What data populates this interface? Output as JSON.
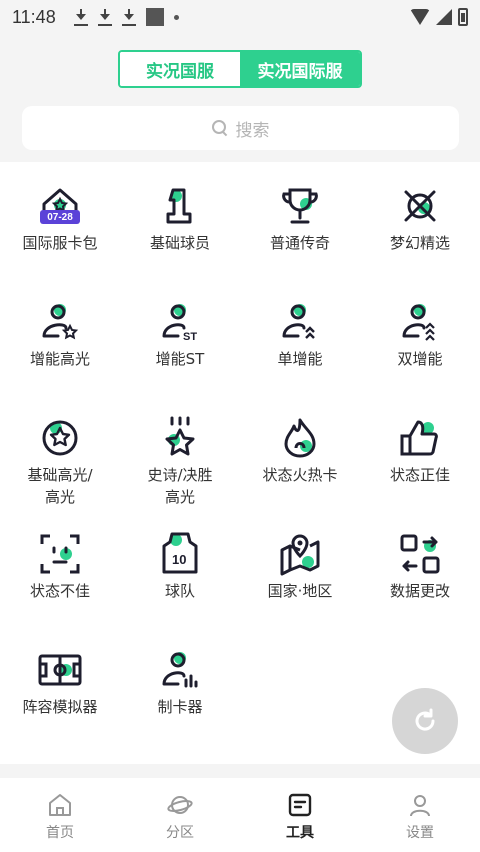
{
  "status_bar": {
    "time": "11:48"
  },
  "toggle": {
    "left_label": "实况国服",
    "right_label": "实况国际服",
    "active": "right"
  },
  "search": {
    "placeholder": "搜索"
  },
  "colors": {
    "accent": "#2ed08f",
    "badge": "#5b42d8"
  },
  "grid": {
    "items": [
      {
        "label": "国际服卡包",
        "icon": "house-star-icon",
        "badge": "07-28"
      },
      {
        "label": "基础球员",
        "icon": "number-one-icon"
      },
      {
        "label": "普通传奇",
        "icon": "trophy-icon"
      },
      {
        "label": "梦幻精选",
        "icon": "crossed-swords-icon"
      },
      {
        "label": "增能高光",
        "icon": "player-star-icon"
      },
      {
        "label": "增能ST",
        "icon": "player-st-icon"
      },
      {
        "label": "单增能",
        "icon": "player-chevron-icon"
      },
      {
        "label": "双增能",
        "icon": "player-double-chevron-icon"
      },
      {
        "label": "基础高光/\n高光",
        "icon": "star-circle-icon"
      },
      {
        "label": "史诗/决胜\n高光",
        "icon": "star-rain-icon"
      },
      {
        "label": "状态火热卡",
        "icon": "flame-icon"
      },
      {
        "label": "状态正佳",
        "icon": "thumbs-up-icon"
      },
      {
        "label": "状态不佳",
        "icon": "scan-face-icon"
      },
      {
        "label": "球队",
        "icon": "jersey-icon",
        "jersey_number": "10"
      },
      {
        "label": "国家·地区",
        "icon": "map-pin-icon"
      },
      {
        "label": "数据更改",
        "icon": "swap-boxes-icon"
      },
      {
        "label": "阵容模拟器",
        "icon": "pitch-icon"
      },
      {
        "label": "制卡器",
        "icon": "player-chart-icon"
      }
    ]
  },
  "refresh_button": {
    "icon": "refresh-icon"
  },
  "bottom_nav": {
    "items": [
      {
        "label": "首页",
        "icon": "home-icon"
      },
      {
        "label": "分区",
        "icon": "planet-icon"
      },
      {
        "label": "工具",
        "icon": "toolbox-icon",
        "active": true
      },
      {
        "label": "设置",
        "icon": "user-icon"
      }
    ]
  }
}
